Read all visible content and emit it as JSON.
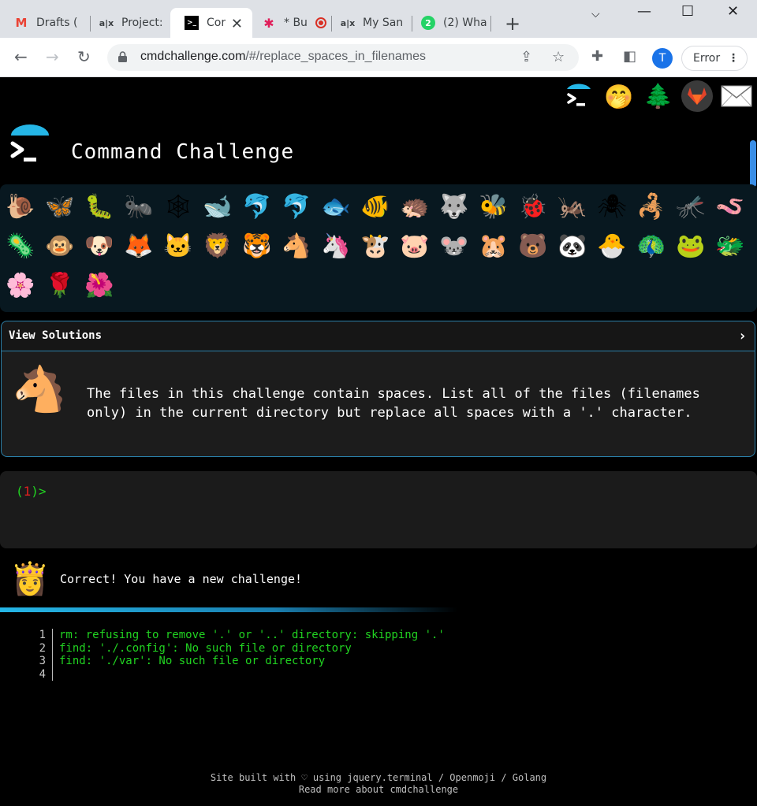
{
  "browser": {
    "tabs": [
      {
        "title": "Drafts (",
        "favicon": "gmail-icon"
      },
      {
        "title": "Project:",
        "favicon": "alx-icon"
      },
      {
        "title": "Cor",
        "favicon": "terminal-icon",
        "active": true
      },
      {
        "title": "* Bu",
        "favicon": "slack-icon"
      },
      {
        "title": "My San",
        "favicon": "alx-icon"
      },
      {
        "title": "(2) Wha",
        "favicon": "whatsapp-icon",
        "badge": "2"
      }
    ],
    "url_domain": "cmdchallenge.com",
    "url_path": "/#/replace_spaces_in_filenames",
    "profile_initial": "T",
    "error_label": "Error"
  },
  "header": {
    "title": "Command Challenge",
    "top_icons": [
      "terminal-icon",
      "hand-over-mouth-icon",
      "tree-icon",
      "gitlab-icon",
      "envelope-icon"
    ]
  },
  "animals": {
    "row1": [
      "🐌",
      "🦋",
      "🐛",
      "🐜",
      "🕸",
      "🐋",
      "🐬",
      "🐬",
      "🐟",
      "🐠",
      "🦔",
      "🐺",
      "🐝",
      "🐞",
      "🦗",
      "🕷",
      "🦂",
      "🦟",
      "🪱"
    ],
    "row2": [
      "🦠",
      "🐵",
      "🐶",
      "🦊",
      "🐱",
      "🦁",
      "🐯",
      "🐴",
      "🦄",
      "🐮",
      "🐷",
      "🐭",
      "🐹",
      "🐻",
      "🐼",
      "🐣",
      "🦚",
      "🐸",
      "🐲"
    ],
    "row3": [
      "🌸",
      "🌹",
      "🌺"
    ]
  },
  "solutions": {
    "header": "View Solutions",
    "icon": "🐴",
    "description": "The files in this challenge contain spaces. List all of the files (filenames only) in the current directory but replace all spaces with a '.' character."
  },
  "terminal": {
    "prompt_open": "(",
    "prompt_num": "1",
    "prompt_close": ")>"
  },
  "result": {
    "icon": "👸",
    "message": "Correct! You have a new challenge!"
  },
  "output": {
    "lines": [
      {
        "n": "1",
        "text": "rm: refusing to remove '.' or '..' directory: skipping '.'"
      },
      {
        "n": "2",
        "text": "find: './.config': No such file or directory"
      },
      {
        "n": "3",
        "text": "find: './var': No such file or directory"
      },
      {
        "n": "4",
        "text": ""
      }
    ]
  },
  "footer": {
    "line1": "Site built with ♡ using jquery.terminal / Openmoji / Golang",
    "line2": "Read more about cmdchallenge"
  }
}
